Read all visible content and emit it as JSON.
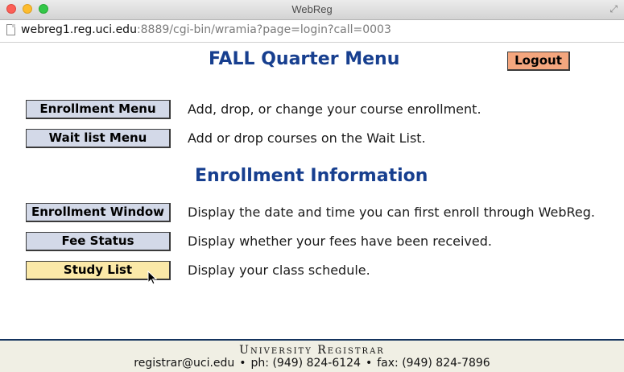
{
  "window": {
    "title": "WebReg",
    "url_host": "webreg1.reg.uci.edu",
    "url_rest": ":8889/cgi-bin/wramia?page=login?call=0003"
  },
  "header": {
    "title": "FALL Quarter Menu",
    "logout_label": "Logout"
  },
  "enrollment_menu": [
    {
      "label": "Enrollment Menu",
      "description": "Add, drop, or change your course enrollment."
    },
    {
      "label": "Wait list Menu",
      "description": "Add or drop courses on the Wait List."
    }
  ],
  "info": {
    "title": "Enrollment Information",
    "items": [
      {
        "label": "Enrollment Window",
        "description": "Display the date and time you can first enroll through WebReg."
      },
      {
        "label": "Fee Status",
        "description": "Display whether your fees have been received."
      },
      {
        "label": "Study List",
        "description": "Display your class schedule."
      }
    ]
  },
  "footer": {
    "org": "University Registrar",
    "email": "registrar@uci.edu",
    "phone": "ph: (949) 824-6124",
    "fax": "fax: (949) 824-7896",
    "bullet": "•"
  },
  "colors": {
    "heading": "#173f8f",
    "button_bg": "#d3d9e8",
    "button_hover_bg": "#fbe9a8",
    "logout_bg": "#f4a67e",
    "footer_bg": "#f0efe4",
    "footer_border": "#15345f"
  }
}
